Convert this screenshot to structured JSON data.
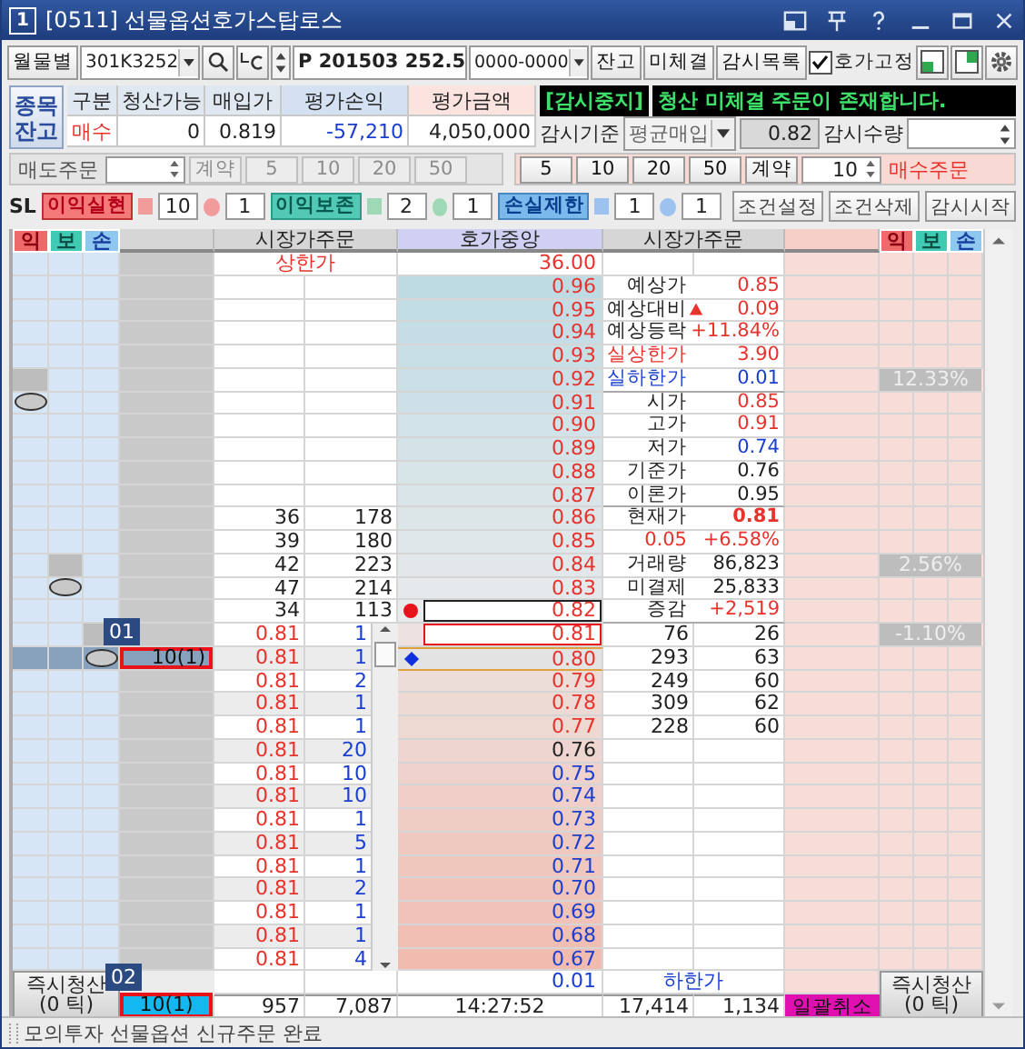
{
  "window": {
    "number": "1",
    "title": "[0511] 선물옵션호가스탑로스"
  },
  "toolbar": {
    "period": "월물별",
    "code": "301K3252",
    "symbol": "P 201503 252.5",
    "account": "0000-0000",
    "buttons": [
      "잔고",
      "미체결",
      "감시목록"
    ],
    "lock": {
      "label": "호가고정",
      "checked": true
    }
  },
  "balance": {
    "toggle": [
      "종목",
      "잔고"
    ],
    "columns": [
      "구분",
      "청산가능",
      "매입가",
      "평가손익",
      "평가금액"
    ],
    "row": [
      {
        "text": "매수",
        "color": "#e8332d"
      },
      {
        "text": "0",
        "color": "#222222"
      },
      {
        "text": "0.819",
        "color": "#222222"
      },
      {
        "text": "-57,210",
        "color": "#1a3fd0"
      },
      {
        "text": "4,050,000",
        "color": "#222222"
      }
    ]
  },
  "monitor": {
    "state": "[감시중지]",
    "message": "청산 미체결 주문이 존재합니다.",
    "basis_label": "감시기준",
    "basis": "평균매입",
    "price": "0.82",
    "qty_label": "감시수량"
  },
  "order_panels": [
    {
      "kind": "sell",
      "label": "매도주문",
      "unit": "계약",
      "disabled": true,
      "amounts": [
        "5",
        "10",
        "20",
        "50"
      ]
    },
    {
      "kind": "buy",
      "label": "매수주문",
      "unit": "계약",
      "disabled": false,
      "amounts": [
        "5",
        "10",
        "20",
        "50"
      ],
      "qty": "10"
    }
  ],
  "stop_loss": {
    "label": "SL",
    "rules": [
      {
        "kind": "profit",
        "label": "이익실현",
        "qty": "10",
        "ticks": "1"
      },
      {
        "kind": "preserve",
        "label": "이익보존",
        "qty": "2",
        "ticks": "1"
      },
      {
        "kind": "loss",
        "label": "손실제한",
        "qty": "1",
        "ticks": "1"
      }
    ],
    "buttons": [
      "조건설정",
      "조건삭제",
      "감시시작"
    ]
  },
  "grid": {
    "headers": {
      "left_marks": [
        {
          "kind": "profit",
          "label": "익"
        },
        {
          "kind": "preserve",
          "label": "보"
        },
        {
          "kind": "loss",
          "label": "손"
        }
      ],
      "sell": "시장가주문",
      "center": "호가중앙",
      "buy": "시장가주문",
      "right_marks": [
        {
          "kind": "profit",
          "label": "익"
        },
        {
          "kind": "preserve",
          "label": "보"
        },
        {
          "kind": "loss",
          "label": "손"
        }
      ]
    },
    "rows": [
      {
        "price": "36.00",
        "color": "#e8332d",
        "selected": false,
        "limit": {
          "kind": "sell",
          "label": "상한가"
        }
      },
      {
        "price": "0.96",
        "color": "#e8332d",
        "kind": "ask",
        "selected": false
      },
      {
        "price": "0.95",
        "color": "#e8332d",
        "kind": "ask",
        "selected": false
      },
      {
        "price": "0.94",
        "color": "#e8332d",
        "kind": "ask",
        "selected": false
      },
      {
        "price": "0.93",
        "color": "#e8332d",
        "kind": "ask",
        "selected": false
      },
      {
        "price": "0.92",
        "color": "#e8332d",
        "kind": "ask",
        "selected": false,
        "tag": "12.33%"
      },
      {
        "price": "0.91",
        "color": "#e8332d",
        "kind": "ask",
        "selected": false,
        "marker": {
          "kind": "profit"
        }
      },
      {
        "price": "0.90",
        "color": "#e8332d",
        "kind": "ask",
        "selected": false
      },
      {
        "price": "0.89",
        "color": "#e8332d",
        "kind": "ask",
        "selected": false
      },
      {
        "price": "0.88",
        "color": "#e8332d",
        "kind": "ask",
        "selected": false
      },
      {
        "price": "0.87",
        "color": "#e8332d",
        "kind": "ask",
        "selected": false
      },
      {
        "price": "0.86",
        "color": "#e8332d",
        "kind": "ask",
        "selected": false,
        "sell": [
          "36",
          "178"
        ]
      },
      {
        "price": "0.85",
        "color": "#e8332d",
        "kind": "ask",
        "selected": false,
        "sell": [
          "39",
          "180"
        ]
      },
      {
        "price": "0.84",
        "color": "#e8332d",
        "kind": "ask",
        "selected": false,
        "sell": [
          "42",
          "223"
        ],
        "tag": "2.56%"
      },
      {
        "price": "0.83",
        "color": "#e8332d",
        "kind": "ask",
        "selected": false,
        "sell": [
          "47",
          "214"
        ],
        "marker": {
          "kind": "preserve"
        }
      },
      {
        "price": "0.82",
        "color": "#e8332d",
        "kind": "ask",
        "selected": false,
        "sell": [
          "34",
          "113"
        ],
        "pointer": {
          "kind": "dot"
        }
      },
      {
        "price": "0.81",
        "color": "#e8332d",
        "kind": "bid",
        "selected": false,
        "current": true,
        "order": [
          "0.81",
          "1"
        ],
        "buy": [
          "76",
          "26"
        ],
        "tag": "-1.10%"
      },
      {
        "price": "0.80",
        "color": "#e8332d",
        "kind": "bid",
        "selected": true,
        "order": [
          "0.81",
          "1"
        ],
        "buy": [
          "293",
          "63"
        ],
        "pending": "10(1)",
        "marker": {
          "kind": "loss"
        },
        "pointer": {
          "kind": "diamond"
        },
        "callout": "01"
      },
      {
        "price": "0.79",
        "color": "#e8332d",
        "kind": "bid",
        "selected": false,
        "order": [
          "0.81",
          "2"
        ],
        "buy": [
          "249",
          "60"
        ]
      },
      {
        "price": "0.78",
        "color": "#e8332d",
        "kind": "bid",
        "selected": false,
        "order": [
          "0.81",
          "1"
        ],
        "buy": [
          "309",
          "62"
        ]
      },
      {
        "price": "0.77",
        "color": "#e8332d",
        "kind": "bid",
        "selected": false,
        "order": [
          "0.81",
          "1"
        ],
        "buy": [
          "228",
          "60"
        ]
      },
      {
        "price": "0.76",
        "color": "#222222",
        "kind": "bid",
        "selected": false,
        "order": [
          "0.81",
          "20"
        ]
      },
      {
        "price": "0.75",
        "color": "#1a3fd0",
        "kind": "bid",
        "selected": false,
        "order": [
          "0.81",
          "10"
        ]
      },
      {
        "price": "0.74",
        "color": "#1a3fd0",
        "kind": "bid",
        "selected": false,
        "order": [
          "0.81",
          "10"
        ]
      },
      {
        "price": "0.73",
        "color": "#1a3fd0",
        "kind": "bid",
        "selected": false,
        "order": [
          "0.81",
          "1"
        ]
      },
      {
        "price": "0.72",
        "color": "#1a3fd0",
        "kind": "bid",
        "selected": false,
        "order": [
          "0.81",
          "5"
        ]
      },
      {
        "price": "0.71",
        "color": "#1a3fd0",
        "kind": "bid",
        "selected": false,
        "order": [
          "0.81",
          "1"
        ]
      },
      {
        "price": "0.70",
        "color": "#1a3fd0",
        "kind": "bid",
        "selected": false,
        "order": [
          "0.81",
          "2"
        ]
      },
      {
        "price": "0.69",
        "color": "#1a3fd0",
        "kind": "bid",
        "selected": false,
        "order": [
          "0.81",
          "1"
        ]
      },
      {
        "price": "0.68",
        "color": "#1a3fd0",
        "kind": "bid",
        "selected": false,
        "order": [
          "0.81",
          "1"
        ]
      },
      {
        "price": "0.67",
        "color": "#1a3fd0",
        "kind": "bid",
        "selected": false,
        "order": [
          "0.81",
          "4"
        ]
      },
      {
        "price": "0.01",
        "color": "#1a3fd0",
        "selected": false,
        "limit": {
          "kind": "buy",
          "label": "하한가"
        }
      }
    ],
    "quote_info": [
      [
        {
          "label": "예상가",
          "value": "0.85",
          "color": "#e8332d"
        },
        {
          "label": "예상대비",
          "value": "0.09",
          "color": "#e8332d",
          "arrow": {
            "kind": "up"
          }
        },
        {
          "label": "예상등락",
          "value": "+11.84%",
          "color": "#e8332d"
        },
        {
          "label": "실상한가",
          "label_style": {
            "color": "#e8332d"
          },
          "value": "3.90",
          "color": "#e8332d"
        },
        {
          "label": "실하한가",
          "label_style": {
            "color": "#1a3fd0"
          },
          "value": "0.01",
          "color": "#1a3fd0"
        }
      ],
      [
        {
          "label": "시가",
          "value": "0.85",
          "color": "#e8332d"
        },
        {
          "label": "고가",
          "value": "0.91",
          "color": "#e8332d"
        },
        {
          "label": "저가",
          "value": "0.74",
          "color": "#1a3fd0"
        },
        {
          "label": "기준가",
          "value": "0.76",
          "color": "#222222"
        },
        {
          "label": "이론가",
          "value": "0.95",
          "color": "#222222"
        }
      ],
      [
        {
          "label": "현재가",
          "value": "0.81",
          "color": "#e8332d",
          "strong": true
        },
        {
          "label": "0.05",
          "label_style": {
            "color": "#e8332d"
          },
          "value": "+6.58%",
          "color": "#e8332d"
        },
        {
          "label": "거래량",
          "value": "86,823",
          "color": "#222222"
        },
        {
          "label": "미결제",
          "value": "25,833",
          "color": "#222222"
        },
        {
          "label": "증감",
          "value": "+2,519",
          "color": "#e8332d"
        }
      ]
    ],
    "footer": {
      "close_left": [
        "즉시청산",
        "(0 틱)"
      ],
      "pending": "10(1)",
      "callout": "02",
      "sell_count": "957",
      "sell_qty": "7,087",
      "time": "14:27:52",
      "buy_qty": "17,414",
      "buy_count": "1,134",
      "cancel_all": "일괄취소",
      "close_right": [
        "즉시청산",
        "(0 틱)"
      ]
    }
  },
  "status_bar": "모의투자 선물옵션 신규주문 완료"
}
